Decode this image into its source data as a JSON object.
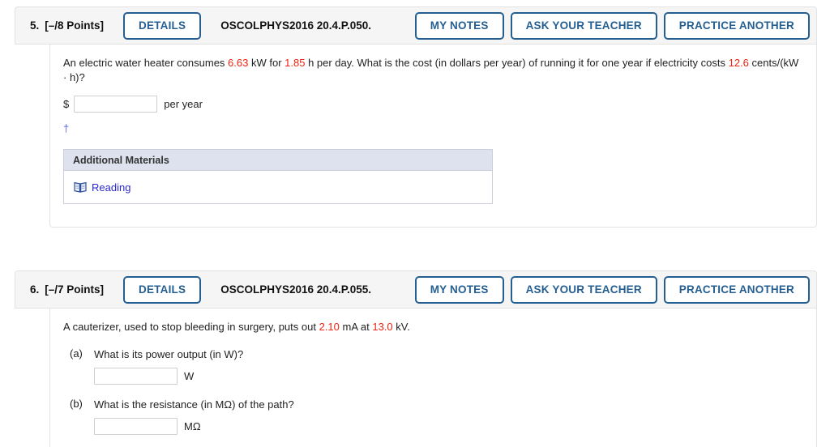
{
  "questions": [
    {
      "number": "5.",
      "points": "[–/8 Points]",
      "details_label": "DETAILS",
      "code": "OSCOLPHYS2016 20.4.P.050.",
      "my_notes_label": "MY NOTES",
      "ask_teacher_label": "ASK YOUR TEACHER",
      "practice_label": "PRACTICE ANOTHER",
      "prompt": {
        "part1": "An electric water heater consumes ",
        "v1": "6.63",
        "part2": " kW for ",
        "v2": "1.85",
        "part3": " h per day. What is the cost (in dollars per year) of running it for one year if electricity costs ",
        "v3": "12.6",
        "part4": " cents/(kW · h)?"
      },
      "currency": "$",
      "answer_value": "",
      "answer_unit": "per year",
      "footnote_symbol": "†",
      "materials": {
        "title": "Additional Materials",
        "link_label": "Reading",
        "icon": "book-icon"
      }
    },
    {
      "number": "6.",
      "points": "[–/7 Points]",
      "details_label": "DETAILS",
      "code": "OSCOLPHYS2016 20.4.P.055.",
      "my_notes_label": "MY NOTES",
      "ask_teacher_label": "ASK YOUR TEACHER",
      "practice_label": "PRACTICE ANOTHER",
      "prompt": {
        "part1": "A cauterizer, used to stop bleeding in surgery, puts out ",
        "v1": "2.10",
        "part2": " mA at ",
        "v2": "13.0",
        "part3": " kV."
      },
      "parts": [
        {
          "label": "(a)",
          "text": "What is its power output (in W)?",
          "answer_value": "",
          "unit": "W"
        },
        {
          "label": "(b)",
          "text": "What is the resistance (in MΩ) of the path?",
          "answer_value": "",
          "unit": "MΩ"
        }
      ]
    }
  ],
  "colors": {
    "accent_blue": "#255f91",
    "value_red": "#ee2211",
    "link_blue": "#2a2ad0",
    "header_bg": "#f5f5f5",
    "materials_header_bg": "#dde2ee"
  }
}
